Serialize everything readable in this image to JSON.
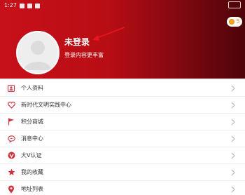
{
  "status": {
    "time": "1:27"
  },
  "points": {
    "value": "5"
  },
  "user": {
    "name": "未登录",
    "tip": "登录内容更丰富"
  },
  "menu": [
    {
      "label": "个人资料",
      "icon": "person-icon"
    },
    {
      "label": "新时代文明实践中心",
      "icon": "heart-icon"
    },
    {
      "label": "积分商城",
      "icon": "flag-icon"
    },
    {
      "label": "消息中心",
      "icon": "chat-bubble-icon"
    },
    {
      "label": "大V认证",
      "icon": "v-badge-icon"
    },
    {
      "label": "我的收藏",
      "icon": "star-icon"
    },
    {
      "label": "地址列表",
      "icon": "location-pin-icon"
    }
  ],
  "colors": {
    "accent": "#c8101a",
    "dark": "#4e0409",
    "coin": "#f5a623"
  }
}
